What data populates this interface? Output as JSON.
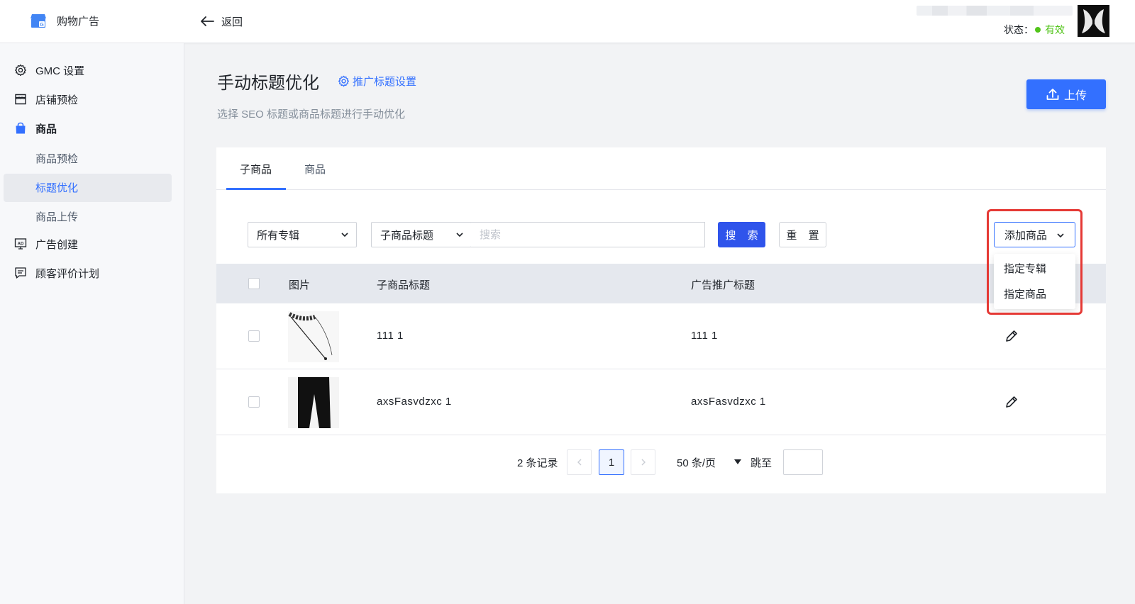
{
  "header": {
    "app_title": "购物广告",
    "back_label": "返回",
    "status_label": "状态：",
    "status_value": "有效"
  },
  "sidebar": {
    "items": [
      {
        "label": "GMC 设置",
        "icon": "gear-icon"
      },
      {
        "label": "店铺预检",
        "icon": "store-icon"
      },
      {
        "label": "商品",
        "icon": "shopping-bag-icon"
      },
      {
        "label": "商品预检"
      },
      {
        "label": "标题优化",
        "active": true
      },
      {
        "label": "商品上传"
      },
      {
        "label": "广告创建",
        "icon": "ad-icon"
      },
      {
        "label": "顾客评价计划",
        "icon": "review-icon"
      }
    ]
  },
  "main": {
    "title": "手动标题优化",
    "promo_settings_link": "推广标题设置",
    "subtitle": "选择 SEO 标题或商品标题进行手动优化",
    "upload_label": "上传",
    "tabs": [
      {
        "label": "子商品",
        "active": true
      },
      {
        "label": "商品"
      }
    ],
    "filters": {
      "album_select": "所有专辑",
      "field_select": "子商品标题",
      "search_placeholder": "搜索",
      "search_button": "搜 索",
      "reset_button": "重 置"
    },
    "add_product": {
      "label": "添加商品",
      "options": [
        "指定专辑",
        "指定商品"
      ]
    },
    "table": {
      "columns": [
        "图片",
        "子商品标题",
        "广告推广标题"
      ],
      "rows": [
        {
          "subtitle": "111 1",
          "ad_title": "111 1",
          "image": "necklace-thumbnail"
        },
        {
          "subtitle": "axsFasvdzxc 1",
          "ad_title": "axsFasvdzxc 1",
          "image": "pants-thumbnail"
        }
      ]
    },
    "pagination": {
      "total": "2 条记录",
      "current_page": "1",
      "page_size": "50 条/页",
      "jump_label": "跳至"
    }
  },
  "colors": {
    "primary": "#3370ff",
    "success": "#52c41a",
    "highlight": "#e53935"
  }
}
